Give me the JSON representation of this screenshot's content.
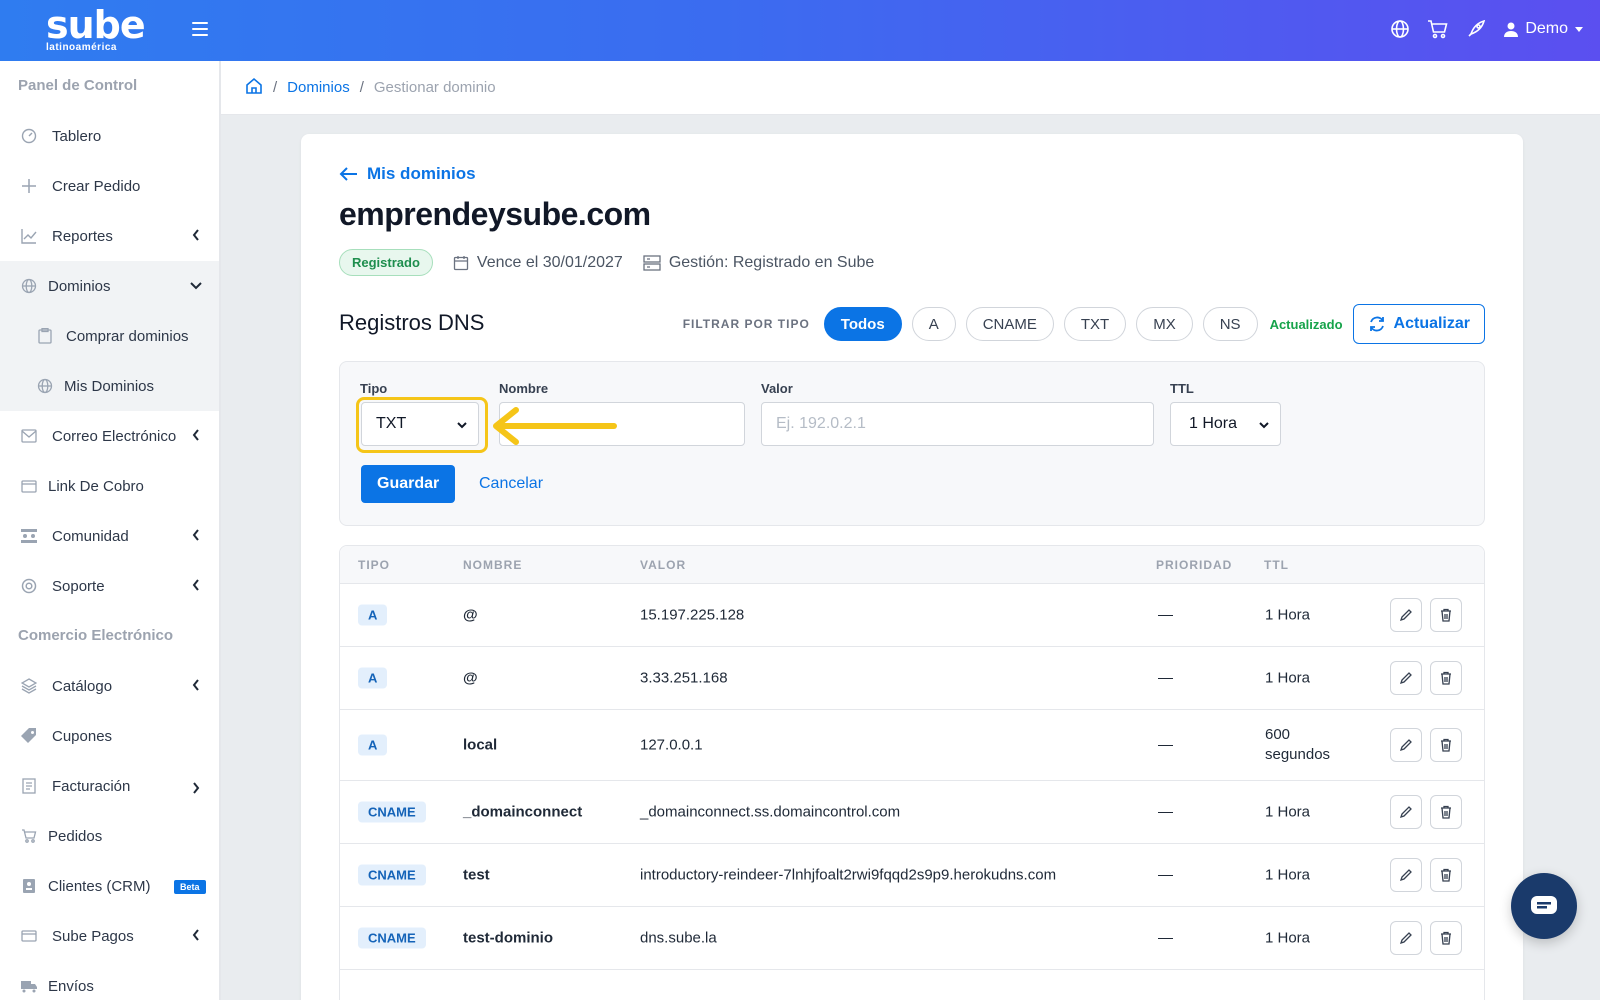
{
  "topbar": {
    "logo_main": "sube",
    "logo_sub": "latinoamérica",
    "user_label": "Demo"
  },
  "sidebar": {
    "section1": "Panel de Control",
    "section2": "Comercio Electrónico",
    "items": [
      {
        "label": "Tablero",
        "icon": "gauge-icon"
      },
      {
        "label": "Crear Pedido",
        "icon": "plus-icon"
      },
      {
        "label": "Reportes",
        "icon": "chart-icon"
      },
      {
        "label": "Dominios",
        "icon": "globe-icon"
      },
      {
        "label": "Comprar dominios",
        "icon": "clipboard-icon"
      },
      {
        "label": "Mis Dominios",
        "icon": "globe-icon"
      },
      {
        "label": "Correo Electrónico",
        "icon": "mail-icon"
      },
      {
        "label": "Link De Cobro",
        "icon": "wallet-icon"
      },
      {
        "label": "Comunidad",
        "icon": "community-icon"
      },
      {
        "label": "Soporte",
        "icon": "lifebuoy-icon"
      },
      {
        "label": "Catálogo",
        "icon": "layers-icon"
      },
      {
        "label": "Cupones",
        "icon": "tag-icon"
      },
      {
        "label": "Facturación",
        "icon": "invoice-icon"
      },
      {
        "label": "Pedidos",
        "icon": "cart-icon"
      },
      {
        "label": "Clientes (CRM)",
        "icon": "contacts-icon",
        "badge": "Beta"
      },
      {
        "label": "Sube Pagos",
        "icon": "card-icon"
      },
      {
        "label": "Envíos",
        "icon": "truck-icon"
      }
    ]
  },
  "breadcrumb": {
    "link": "Dominios",
    "current": "Gestionar dominio"
  },
  "domain": {
    "back_label": "Mis dominios",
    "name": "emprendeysube.com",
    "status": "Registrado",
    "expires": "Vence el 30/01/2027",
    "management": "Gestión: Registrado en Sube"
  },
  "dns": {
    "title": "Registros DNS",
    "filter_label": "FILTRAR POR TIPO",
    "filters": [
      "Todos",
      "A",
      "CNAME",
      "TXT",
      "MX",
      "NS"
    ],
    "active_filter": "Todos",
    "updated_label": "Actualizado",
    "refresh_label": "Actualizar"
  },
  "form": {
    "type_label": "Tipo",
    "type_value": "TXT",
    "name_label": "Nombre",
    "name_value": "",
    "value_label": "Valor",
    "value_placeholder": "Ej. 192.0.2.1",
    "ttl_label": "TTL",
    "ttl_value": "1 Hora",
    "save_label": "Guardar",
    "cancel_label": "Cancelar"
  },
  "table": {
    "headers": {
      "type": "TIPO",
      "name": "NOMBRE",
      "value": "VALOR",
      "priority": "PRIORIDAD",
      "ttl": "TTL"
    },
    "rows": [
      {
        "type": "A",
        "name": "@",
        "value": "15.197.225.128",
        "priority": "—",
        "ttl": "1 Hora"
      },
      {
        "type": "A",
        "name": "@",
        "value": "3.33.251.168",
        "priority": "—",
        "ttl": "1 Hora"
      },
      {
        "type": "A",
        "name": "local",
        "value": "127.0.0.1",
        "priority": "—",
        "ttl": "600 segundos"
      },
      {
        "type": "CNAME",
        "name": "_domainconnect",
        "value": "_domainconnect.ss.domaincontrol.com",
        "priority": "—",
        "ttl": "1 Hora"
      },
      {
        "type": "CNAME",
        "name": "test",
        "value": "introductory-reindeer-7lnhjfoalt2rwi9fqqd2s9p9.herokudns.com",
        "priority": "—",
        "ttl": "1 Hora"
      },
      {
        "type": "CNAME",
        "name": "test-dominio",
        "value": "dns.sube.la",
        "priority": "—",
        "ttl": "1 Hora"
      }
    ]
  },
  "colors": {
    "accent": "#0b74e5",
    "highlight": "#f5c518",
    "success": "#16a34a"
  }
}
